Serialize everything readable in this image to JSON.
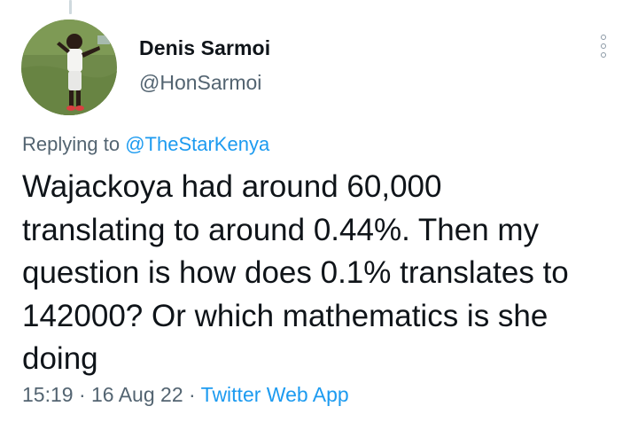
{
  "tweet": {
    "author": {
      "display_name": "Denis Sarmoi",
      "handle": "@HonSarmoi",
      "avatar_icon": "profile-photo-man-on-grass"
    },
    "replying_to": {
      "label": "Replying to",
      "handle": "@TheStarKenya"
    },
    "text_lines": [
      "Wajackoya had around 60,000",
      "translating to around 0.44%. Then my",
      "question is how does 0.1% translates to",
      "142000? Or which mathematics is she",
      "doing"
    ],
    "meta": {
      "time": "15:19",
      "separator": "·",
      "date": "16 Aug 22",
      "source": "Twitter Web App"
    },
    "more_icon": "more-options-vertical-icon"
  },
  "colors": {
    "text_primary": "#0f1419",
    "text_secondary": "#536471",
    "link": "#1d9bf0",
    "thread_line": "#cfd9de"
  }
}
